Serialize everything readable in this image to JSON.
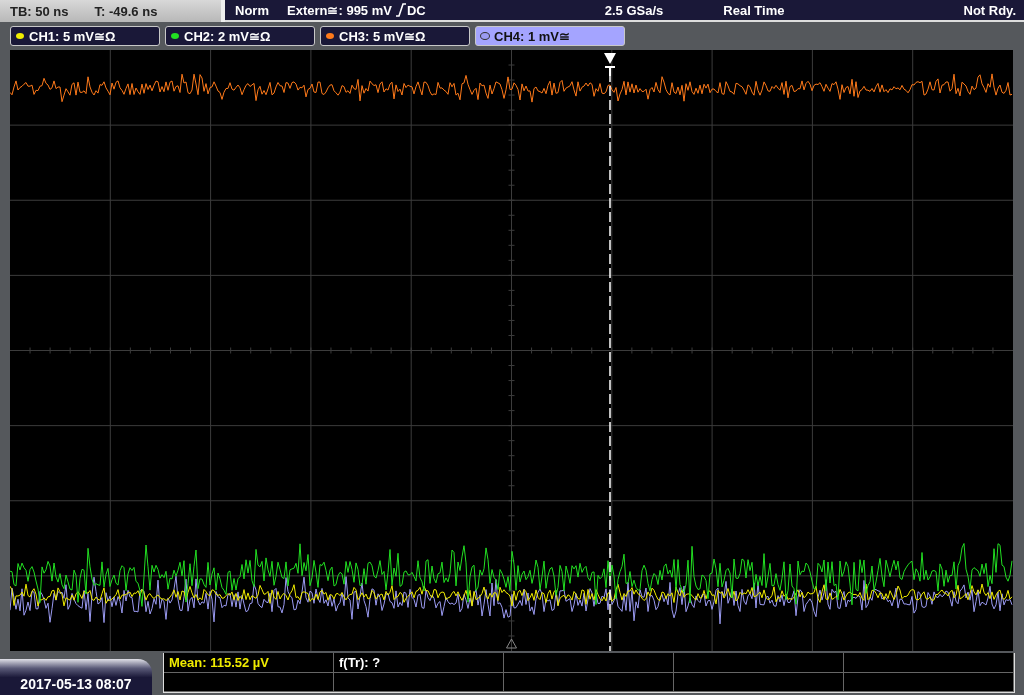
{
  "header": {
    "timebase": "TB: 50 ns",
    "trigger_time": "T: -49.6 ns",
    "trigger_mode": "Norm",
    "trigger_source": "Extern≅: 995 mV",
    "trigger_coupling": "DC",
    "sample_rate": "2.5 GSa/s",
    "acquisition_mode": "Real Time",
    "status": "Not Rdy."
  },
  "channels": [
    {
      "label": "CH1: 5 mV≅Ω",
      "color": "#f0ec00",
      "selected": false
    },
    {
      "label": "CH2: 2 mV≅Ω",
      "color": "#22e022",
      "selected": false
    },
    {
      "label": "CH3: 5 mV≅Ω",
      "color": "#ff7a1a",
      "selected": false
    },
    {
      "label": "CH4: 1 mV≅",
      "color": "#9b9bf2",
      "selected": true
    }
  ],
  "measurements": [
    {
      "text": "Mean: 115.52 µV",
      "color": "#f0ec00"
    },
    {
      "text": "f(Tr): ?",
      "color": "#ffffff"
    }
  ],
  "date": "2017-05-13 08:07"
}
